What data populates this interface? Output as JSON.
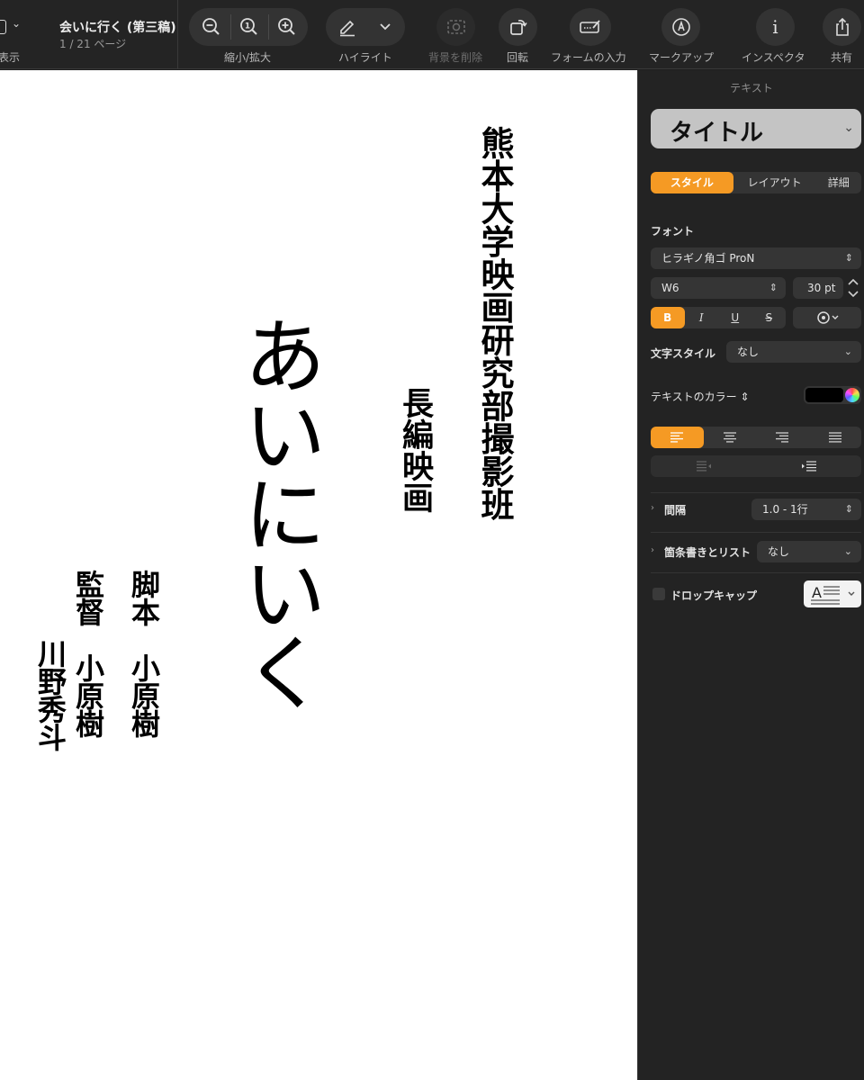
{
  "toolbar": {
    "view_label": "表示",
    "doc_title": "会いに行く (第三稿)",
    "page_info": "1 / 21 ページ",
    "zoom_label": "縮小/拡大",
    "highlight_label": "ハイライト",
    "remove_bg_label": "背景を削除",
    "rotate_label": "回転",
    "form_fill_label": "フォームの入力",
    "markup_label": "マークアップ",
    "inspector_label": "インスペクタ",
    "share_label": "共有",
    "zoom_actual_glyph": "1",
    "inspector_glyph": "i"
  },
  "document": {
    "club": "熊本大学映画研究部撮影班",
    "genre": "長編映画",
    "title": "あいにいく",
    "credit_script": "脚本　小原樹",
    "credit_director": "監督　小原樹",
    "credit_director2": "川野秀斗"
  },
  "inspector": {
    "header": "テキスト",
    "paragraph_style": "タイトル",
    "tabs": [
      "スタイル",
      "レイアウト",
      "詳細"
    ],
    "active_tab": 0,
    "font_section": "フォント",
    "font_family": "ヒラギノ角ゴ ProN",
    "font_weight": "W6",
    "font_size": "30 pt",
    "format_buttons": [
      "B",
      "I",
      "U",
      "S"
    ],
    "char_style_label": "文字スタイル",
    "char_style_value": "なし",
    "text_color_label": "テキストのカラー",
    "text_color": "#000000",
    "spacing_label": "間隔",
    "spacing_value": "1.0 - 1行",
    "bullets_label": "箇条書きとリスト",
    "bullets_value": "なし",
    "dropcap_label": "ドロップキャップ",
    "dropcap_glyph": "A",
    "accent_color": "#f59a24"
  }
}
